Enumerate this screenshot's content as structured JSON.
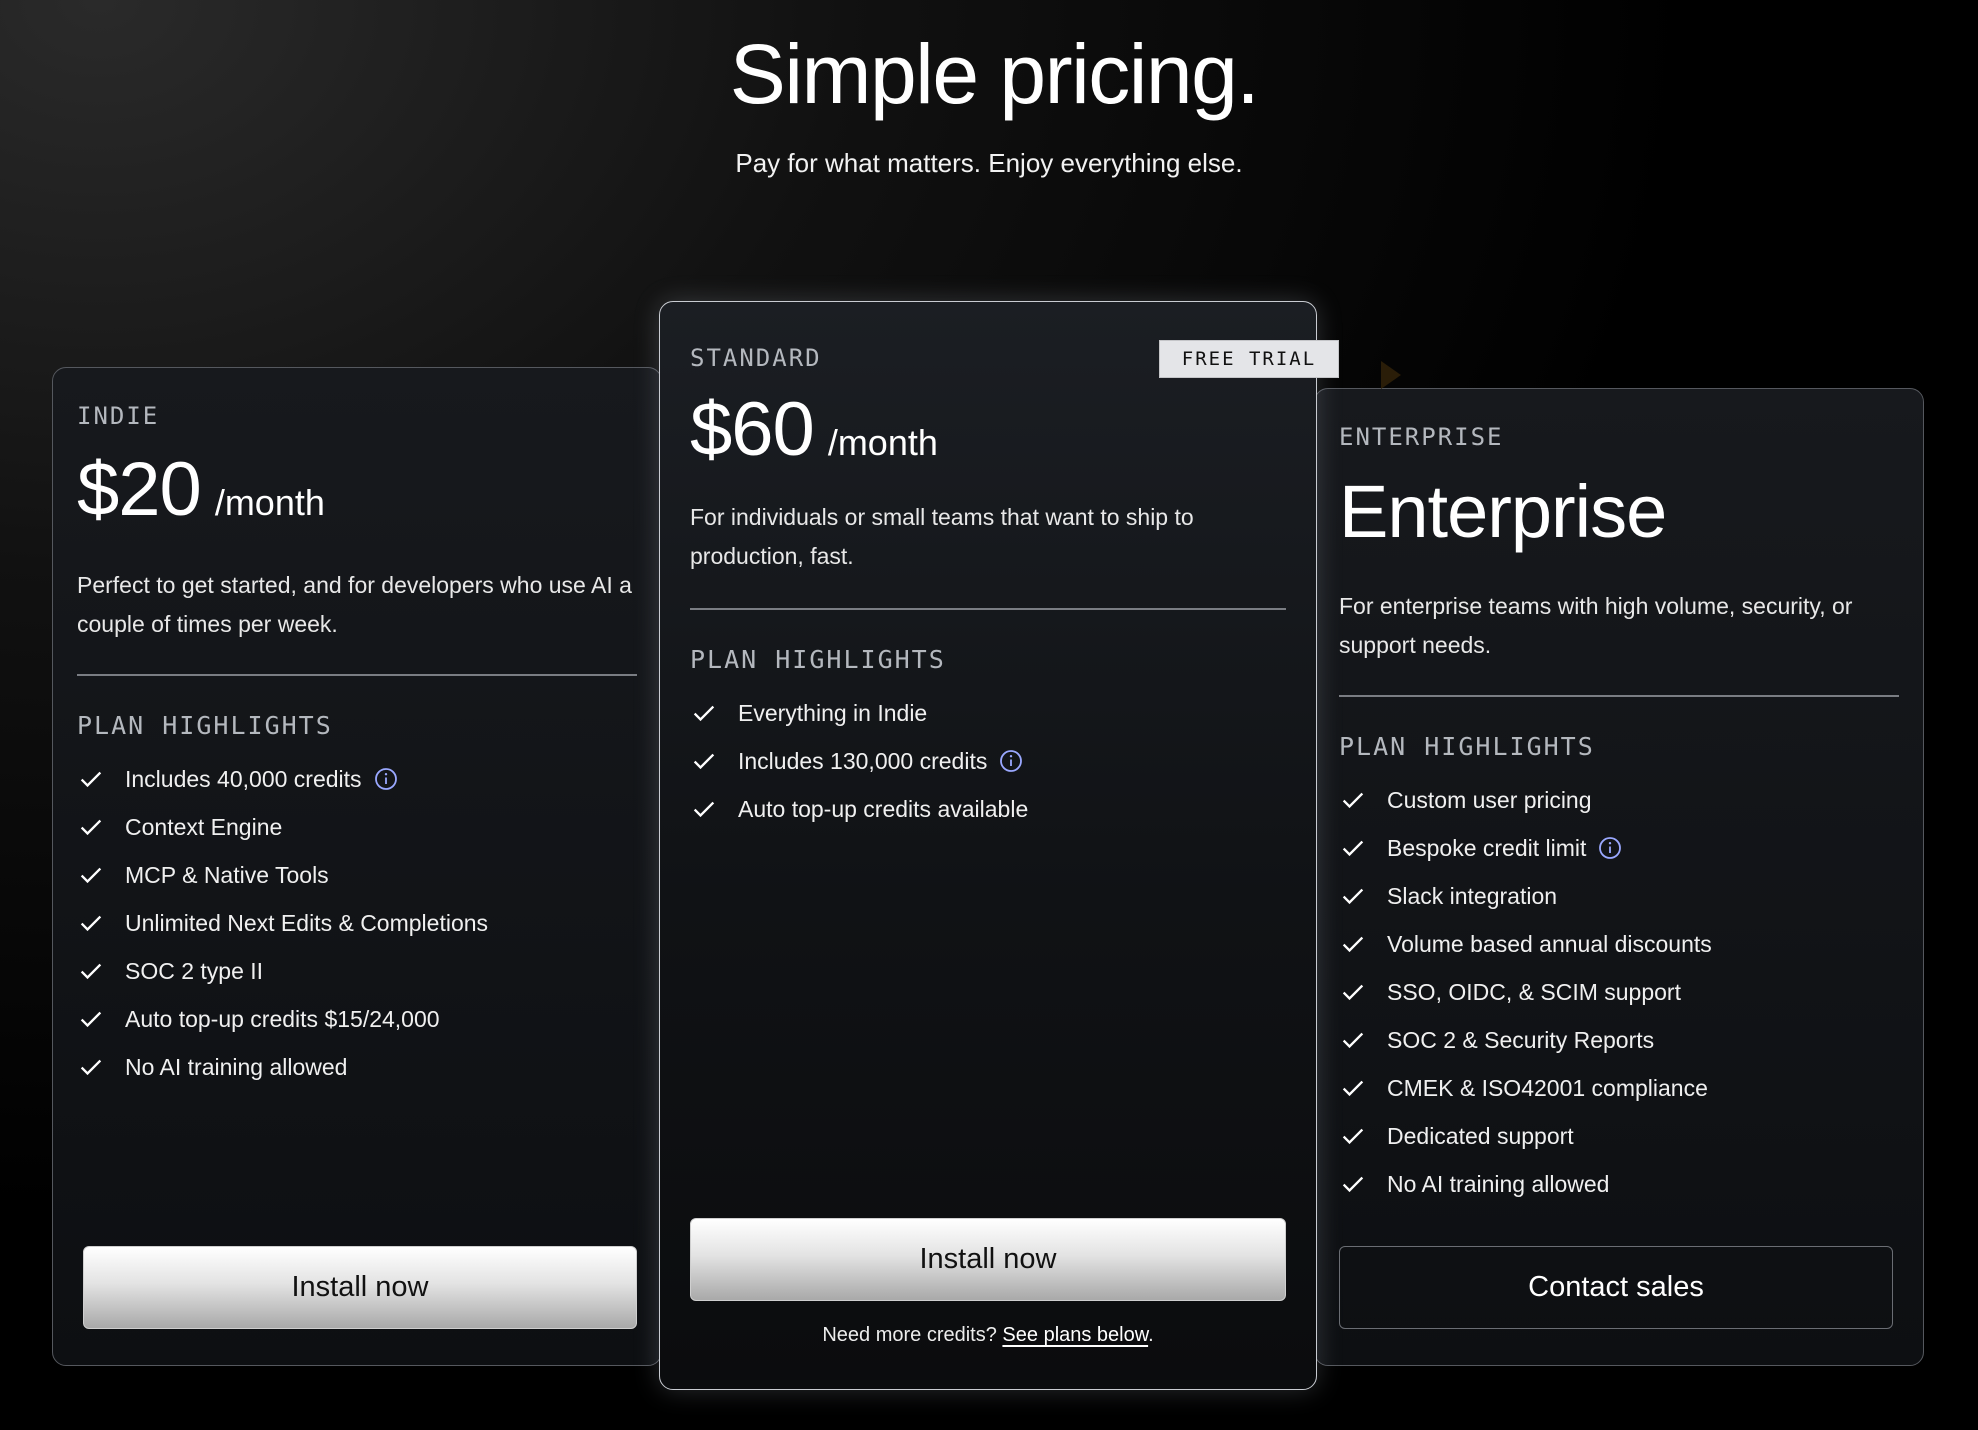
{
  "hero": {
    "title": "Simple pricing.",
    "subtitle": "Pay for what matters. Enjoy everything else."
  },
  "plans": {
    "indie": {
      "tier": "INDIE",
      "price": "$20",
      "period": "/month",
      "description": "Perfect to get started, and for developers who use AI a couple of times per week.",
      "highlights_label": "PLAN HIGHLIGHTS",
      "features": [
        "Includes 40,000 credits",
        "Context Engine",
        "MCP & Native Tools",
        "Unlimited Next Edits & Completions",
        "SOC 2 type II",
        "Auto top-up credits $15/24,000",
        "No AI training allowed"
      ],
      "cta": "Install now"
    },
    "standard": {
      "tier": "STANDARD",
      "badge": "FREE TRIAL",
      "price": "$60",
      "period": "/month",
      "description": "For individuals or small teams that want to ship to production, fast.",
      "highlights_label": "PLAN HIGHLIGHTS",
      "features": [
        "Everything in Indie",
        "Includes 130,000 credits",
        "Auto top-up credits available"
      ],
      "cta": "Install now",
      "more_credits_text": "Need more credits?",
      "more_credits_link": "See plans below",
      "more_credits_end": "."
    },
    "enterprise": {
      "tier": "ENTERPRISE",
      "title": "Enterprise",
      "description": "For enterprise teams with high volume, security, or support needs.",
      "highlights_label": "PLAN HIGHLIGHTS",
      "features": [
        "Custom user pricing",
        "Bespoke credit limit",
        "Slack integration",
        "Volume based annual discounts",
        "SSO, OIDC, & SCIM support",
        "SOC 2 & Security Reports",
        "CMEK & ISO42001 compliance",
        "Dedicated support",
        "No AI training allowed"
      ],
      "cta": "Contact sales"
    }
  },
  "icons": {
    "check": "check-icon",
    "info": "info-icon"
  },
  "colors": {
    "background": "#000000",
    "text": "#ffffff",
    "muted": "#b4b8be",
    "badge_bg": "#e4e5e8"
  }
}
